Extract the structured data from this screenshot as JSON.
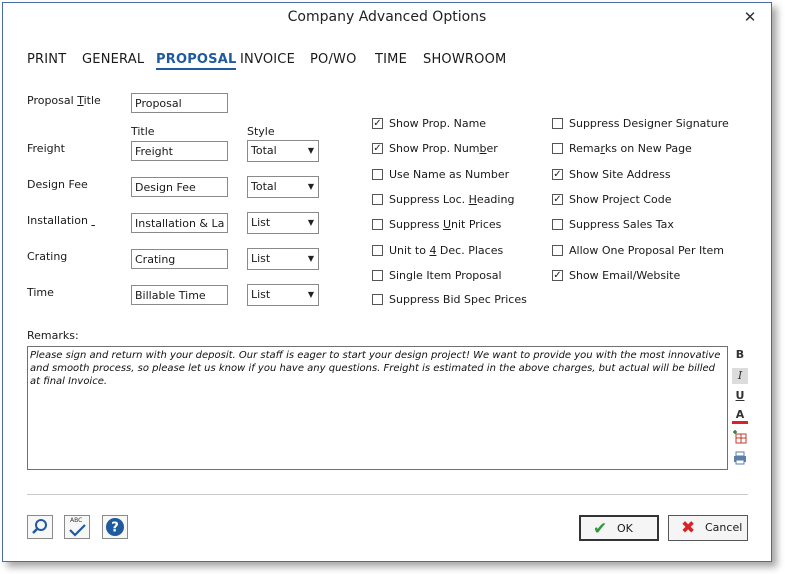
{
  "window": {
    "title": "Company Advanced Options",
    "close": "✕"
  },
  "tabs": [
    {
      "label": "PRINT"
    },
    {
      "label": "GENERAL"
    },
    {
      "label": "PROPOSAL",
      "active": true
    },
    {
      "label": "INVOICE"
    },
    {
      "label": "PO/WO"
    },
    {
      "label": "TIME"
    },
    {
      "label": "SHOWROOM"
    }
  ],
  "proposal_title": {
    "label_pre": "Proposal ",
    "label_u": "T",
    "label_post": "itle",
    "value": "Proposal"
  },
  "columns": {
    "title": "Title",
    "style": "Style"
  },
  "rows": [
    {
      "label": "Freight",
      "title": "Freight",
      "style": "Total"
    },
    {
      "label": "Design Fee",
      "title": "Design Fee",
      "style": "Total"
    },
    {
      "label": "Installation",
      "title": "Installation & La",
      "style": "List"
    },
    {
      "label": "Crating",
      "title": "Crating",
      "style": "List"
    },
    {
      "label": "Time",
      "title": "Billable Time",
      "style": "List"
    }
  ],
  "checkboxes_left": [
    {
      "pre": "Show Prop. Name",
      "u": "",
      "post": "",
      "checked": true
    },
    {
      "pre": "Show Prop. Num",
      "u": "b",
      "post": "er",
      "checked": true
    },
    {
      "pre": "Use Name as Number",
      "u": "",
      "post": "",
      "checked": false
    },
    {
      "pre": "Suppress Loc. ",
      "u": "H",
      "post": "eading",
      "checked": false
    },
    {
      "pre": "Suppress ",
      "u": "U",
      "post": "nit Prices",
      "checked": false
    },
    {
      "pre": "Unit to ",
      "u": "4",
      "post": " Dec. Places",
      "checked": false
    },
    {
      "pre": "Single Item Proposal",
      "u": "",
      "post": "",
      "checked": false
    },
    {
      "pre": "Suppress Bid Spec Prices",
      "u": "",
      "post": "",
      "checked": false
    }
  ],
  "checkboxes_right": [
    {
      "pre": "Suppress Designer Signature",
      "u": "",
      "post": "",
      "checked": false
    },
    {
      "pre": "Rema",
      "u": "r",
      "post": "ks on New Page",
      "checked": false
    },
    {
      "pre": "Show Site Address",
      "u": "",
      "post": "",
      "checked": true
    },
    {
      "pre": "Show Project Code",
      "u": "",
      "post": "",
      "checked": true
    },
    {
      "pre": "Suppress Sales Tax",
      "u": "",
      "post": "",
      "checked": false
    },
    {
      "pre": "Allow One Proposal Per Item",
      "u": "",
      "post": "",
      "checked": false
    },
    {
      "pre": "Show Email/Website",
      "u": "",
      "post": "",
      "checked": true
    }
  ],
  "remarks": {
    "label": "Remarks:",
    "text": "Please sign and return with your deposit.  Our staff is eager to start your design project! We want to provide you with the most innovative and smooth process, so please let us know if you have any questions.  Freight is estimated in the above charges, but actual will be billed at final Invoice."
  },
  "format_tools": {
    "bold": "B",
    "italic": "I",
    "underline": "U",
    "color": "A"
  },
  "buttons": {
    "ok": "OK",
    "cancel": "Cancel",
    "spell_text": "ABC"
  },
  "colors": {
    "accent": "#1f5a9e",
    "ok_check": "#2e9a3a",
    "cancel_x": "#d8232a",
    "help": "#1f5a9e"
  }
}
